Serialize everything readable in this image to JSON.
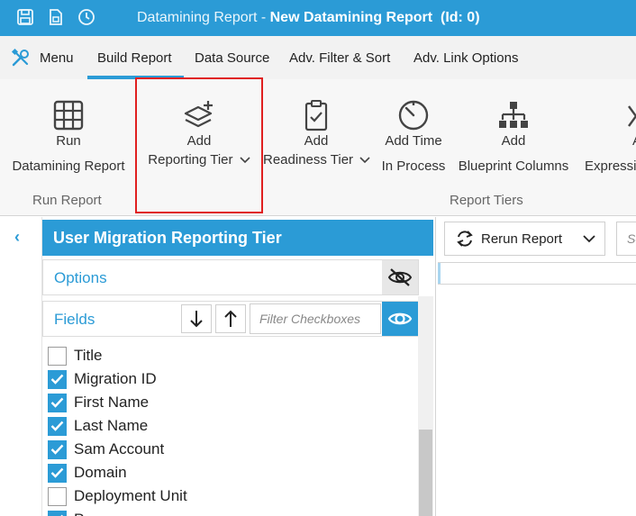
{
  "window": {
    "title_prefix": "Datamining Report - ",
    "title_main": "New Datamining Report",
    "title_id": "(Id: 0)"
  },
  "menubar": {
    "menu_label": "Menu",
    "tabs": [
      "Build Report",
      "Data Source",
      "Adv. Filter & Sort",
      "Adv. Link Options"
    ],
    "active_tab": "Build Report"
  },
  "ribbon": {
    "buttons": [
      {
        "line1": "Run",
        "line2": "Datamining Report",
        "icon": "grid-icon"
      },
      {
        "line1": "Add",
        "line2": "Reporting Tier",
        "icon": "layers-add-icon",
        "dropdown": true
      },
      {
        "line1": "Add",
        "line2": "Readiness Tier",
        "icon": "clipboard-check-icon",
        "dropdown": true
      },
      {
        "line1": "Add Time",
        "line2": "In Process",
        "icon": "timer-icon"
      },
      {
        "line1": "Add",
        "line2": "Blueprint Columns",
        "icon": "hierarchy-icon"
      },
      {
        "line1": "A",
        "line2": "Expressio",
        "icon": "cross-icon"
      }
    ],
    "groups": [
      "Run Report",
      "Report Tiers"
    ]
  },
  "panel": {
    "title": "User Migration Reporting Tier",
    "options_label": "Options",
    "fields_label": "Fields",
    "filter_placeholder": "Filter Checkboxes",
    "fields": [
      {
        "label": "Title",
        "checked": false
      },
      {
        "label": "Migration ID",
        "checked": true
      },
      {
        "label": "First Name",
        "checked": true
      },
      {
        "label": "Last Name",
        "checked": true
      },
      {
        "label": "Sam Account",
        "checked": true
      },
      {
        "label": "Domain",
        "checked": true
      },
      {
        "label": "Deployment Unit",
        "checked": false
      },
      {
        "label": "Process",
        "checked": true
      }
    ]
  },
  "right": {
    "rerun_label": "Rerun Report",
    "search_placeholder": "Se"
  },
  "colors": {
    "accent": "#2b9bd6",
    "highlight_border": "#e02020"
  }
}
